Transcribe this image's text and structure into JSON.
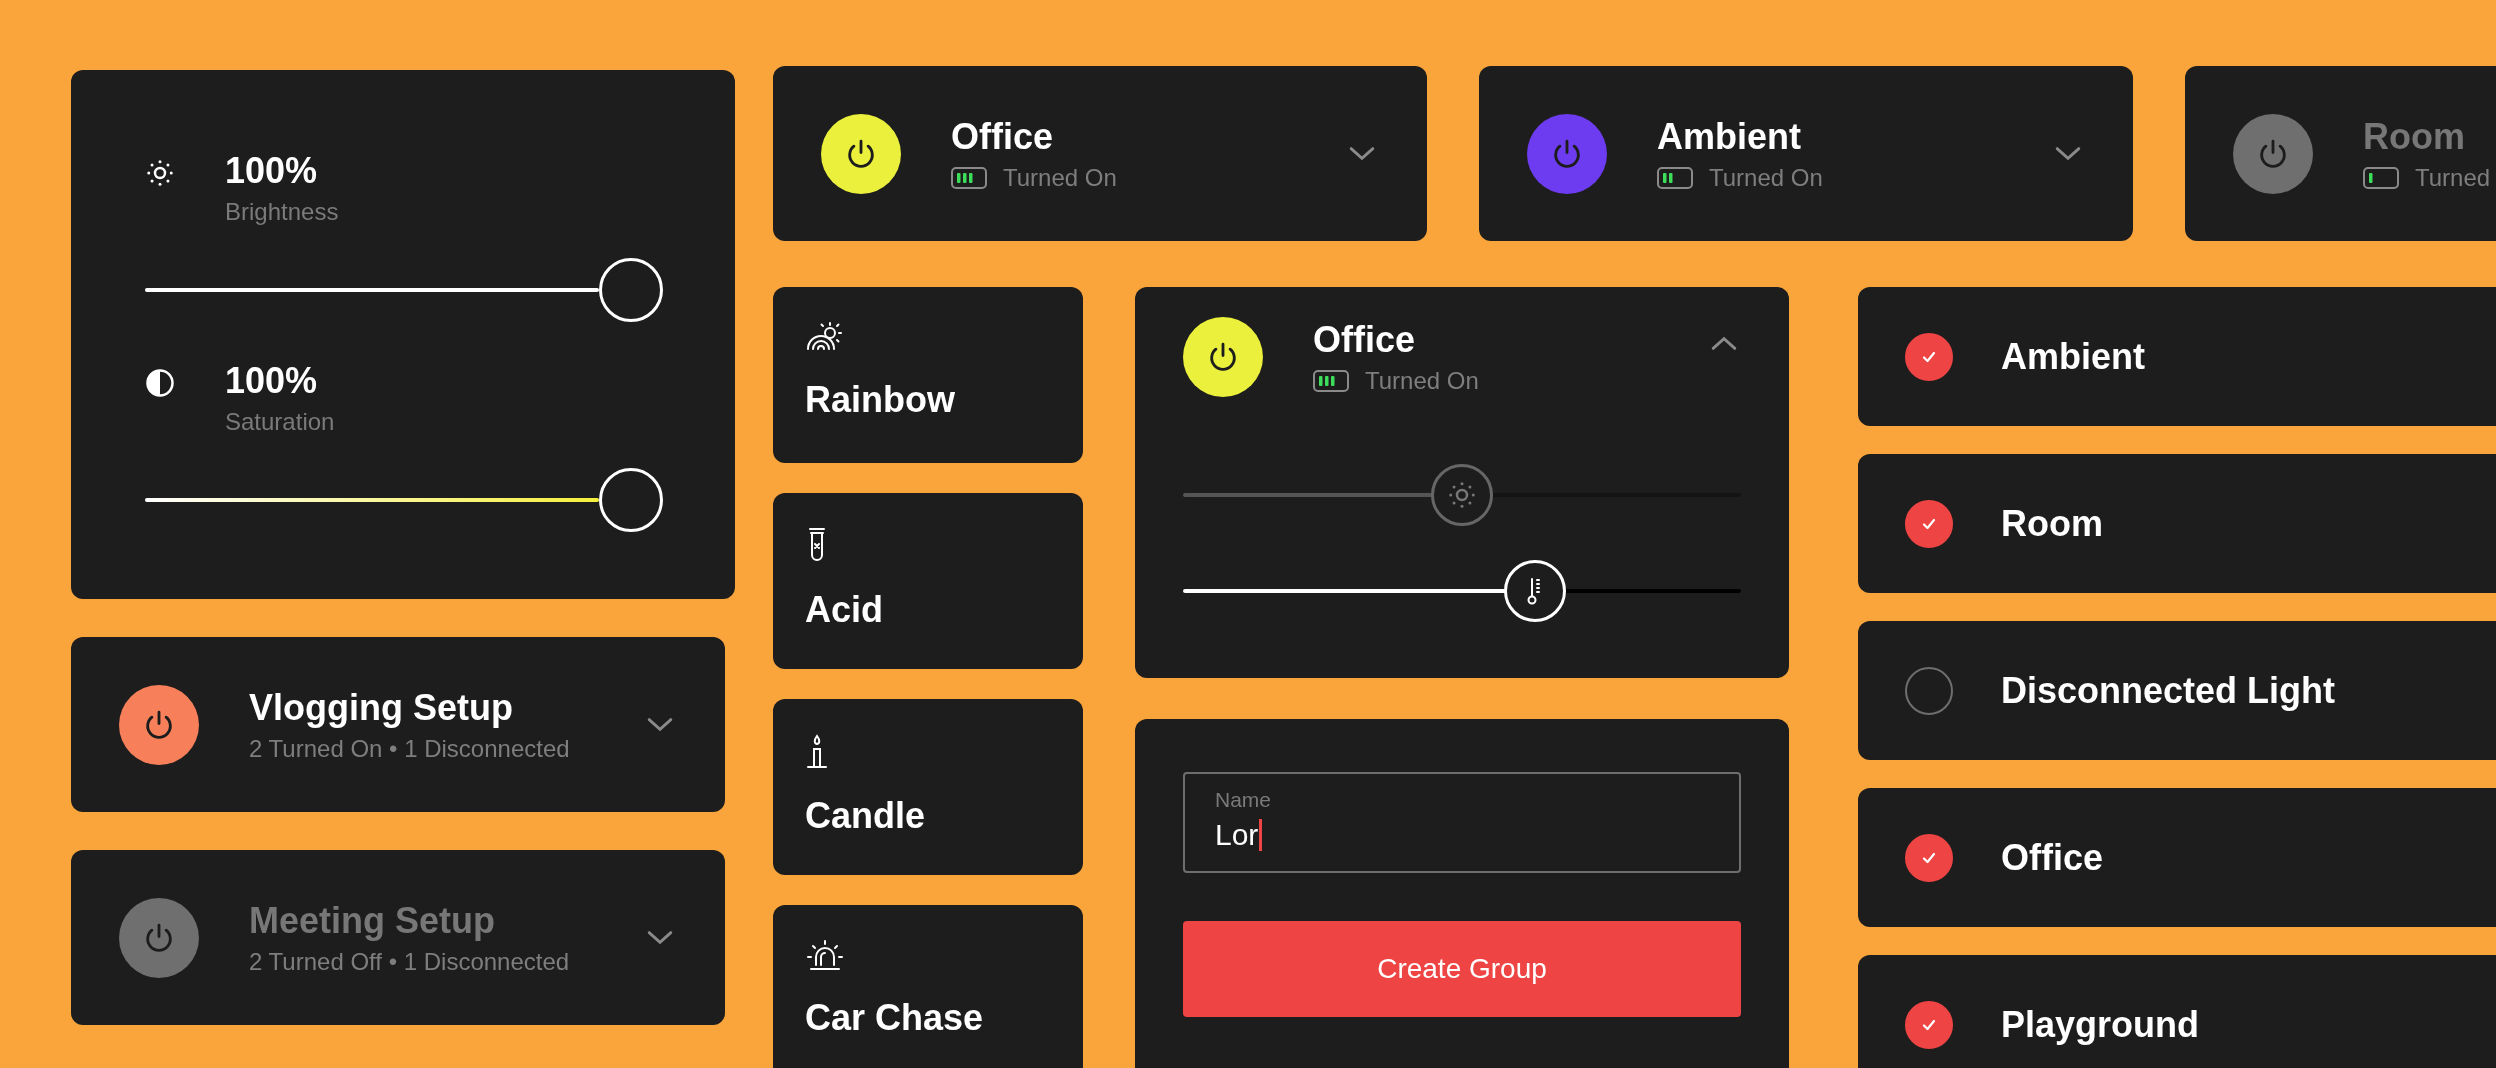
{
  "adjust_card": {
    "sliders": [
      {
        "value": "100%",
        "label": "Brightness",
        "level": 1,
        "kind": "brightness"
      },
      {
        "value": "100%",
        "label": "Saturation",
        "level": 1,
        "kind": "saturation"
      }
    ]
  },
  "light_cards": [
    {
      "name": "Office",
      "status": "Turned On",
      "color": "#eaf03c",
      "dimmed": false,
      "expanded": false
    },
    {
      "name": "Ambient",
      "status": "Turned On",
      "color": "#6d3cf0",
      "dimmed": false,
      "expanded": false
    },
    {
      "name": "Room",
      "status": "Turned",
      "color": "#6f6f6f",
      "dimmed": true,
      "expanded": false
    }
  ],
  "group_cards": [
    {
      "name": "Vlogging Setup",
      "status": "2 Turned On • 1 Disconnected",
      "color": "#f7805a",
      "dimmed": false,
      "expanded": false
    },
    {
      "name": "Meeting Setup",
      "status": "2 Turned Off • 1 Disconnected",
      "color": "#6f6f6f",
      "dimmed": true,
      "expanded": false
    }
  ],
  "scenes": [
    {
      "name": "Rainbow"
    },
    {
      "name": "Acid"
    },
    {
      "name": "Candle"
    },
    {
      "name": "Car Chase"
    }
  ],
  "expanded_light": {
    "name": "Office",
    "status": "Turned On",
    "color": "#eaf03c",
    "expanded": true,
    "sliders": [
      {
        "kind": "brightness",
        "level": 0.5,
        "dimmed": true
      },
      {
        "kind": "temperature",
        "level": 0.63,
        "dimmed": false
      }
    ]
  },
  "group_form": {
    "field": {
      "label": "Name",
      "value": "Lor"
    },
    "button": "Create Group"
  },
  "member_list": [
    {
      "name": "Ambient",
      "checked": true
    },
    {
      "name": "Room",
      "checked": true
    },
    {
      "name": "Disconnected Light",
      "checked": false
    },
    {
      "name": "Office",
      "checked": true
    },
    {
      "name": "Playground",
      "checked": true
    }
  ]
}
